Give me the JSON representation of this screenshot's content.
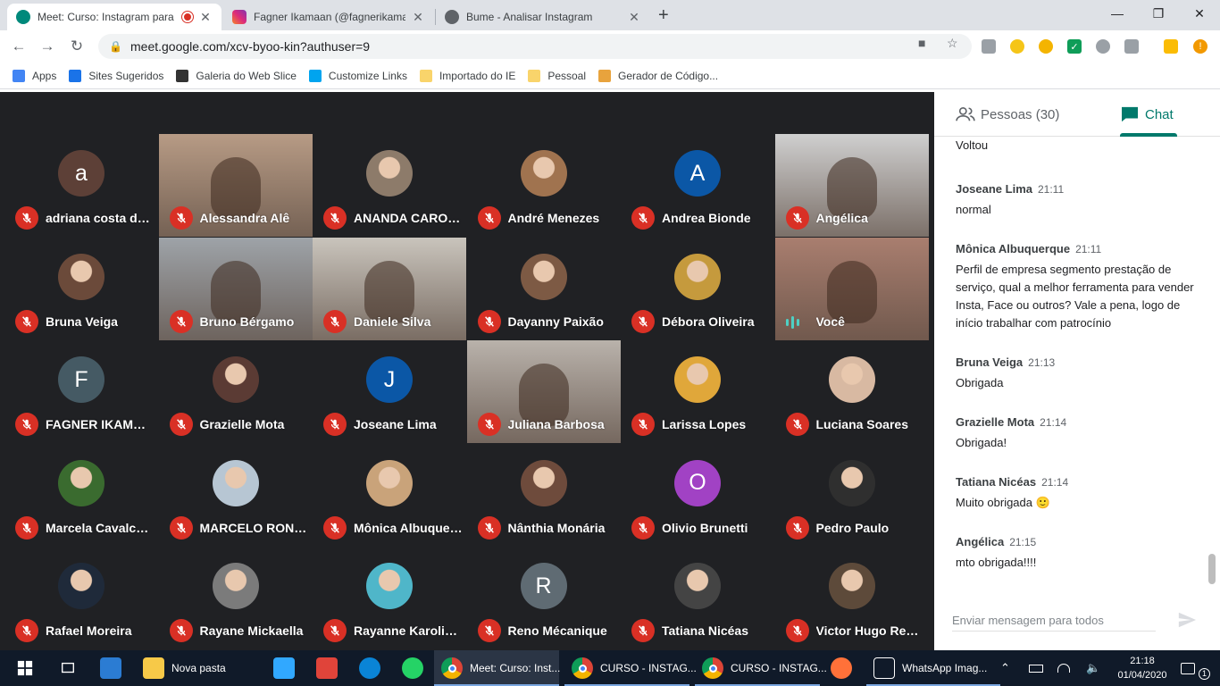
{
  "browser": {
    "tabs": [
      {
        "title": "Meet: Curso: Instagram para",
        "color": "#00897b"
      },
      {
        "title": "Fagner Ikamaan (@fagnerikamaan",
        "color": "#c13584"
      },
      {
        "title": "Bume - Analisar Instagram",
        "color": "#5f6368"
      }
    ],
    "new_tab": "+",
    "window_controls": {
      "minimize": "—",
      "maximize": "❐",
      "close": "✕"
    },
    "url": "meet.google.com/xcv-byoo-kin?authuser=9",
    "bookmarks": [
      {
        "label": "Apps",
        "color": "#4285f4"
      },
      {
        "label": "Sites Sugeridos",
        "color": "#1a73e8"
      },
      {
        "label": "Galeria do Web Slice",
        "color": "#333333"
      },
      {
        "label": "Customize Links",
        "color": "#00a4ef"
      },
      {
        "label": "Importado do IE",
        "color": "#f9d46b"
      },
      {
        "label": "Pessoal",
        "color": "#f9d46b"
      },
      {
        "label": "Gerador de Código...",
        "color": "#e8a33d"
      }
    ]
  },
  "participants": [
    {
      "name": "adriana costa de m...",
      "initial": "a",
      "avatar_color": "#5d4037",
      "type": "initial"
    },
    {
      "name": "Alessandra Alê",
      "type": "video",
      "bg": "#b79b85"
    },
    {
      "name": "ANANDA CAROLIN...",
      "type": "photo",
      "avatar_color": "#8d7b6a"
    },
    {
      "name": "André Menezes",
      "type": "photo",
      "avatar_color": "#a0734f"
    },
    {
      "name": "Andrea Bionde",
      "initial": "A",
      "avatar_color": "#0b57a6",
      "type": "initial"
    },
    {
      "name": "Angélica",
      "type": "video",
      "bg": "#cfcfcf"
    },
    {
      "name": "Bruna Veiga",
      "type": "photo",
      "avatar_color": "#6b4a3a"
    },
    {
      "name": "Bruno Bérgamo",
      "type": "video",
      "bg": "#9ea3a8"
    },
    {
      "name": "Daniele Silva",
      "type": "video",
      "bg": "#c9c4bc"
    },
    {
      "name": "Dayanny Paixão",
      "type": "photo",
      "avatar_color": "#7d5a44"
    },
    {
      "name": "Débora Oliveira",
      "type": "photo",
      "avatar_color": "#c59a3d"
    },
    {
      "name": "Você",
      "type": "video-self",
      "bg": "#a97e6f"
    },
    {
      "name": "FAGNER IKAMAAN...",
      "initial": "F",
      "avatar_color": "#455a64",
      "type": "initial"
    },
    {
      "name": "Grazielle Mota",
      "type": "photo",
      "avatar_color": "#5b3b34"
    },
    {
      "name": "Joseane Lima",
      "initial": "J",
      "avatar_color": "#0b57a6",
      "type": "initial"
    },
    {
      "name": "Juliana Barbosa",
      "type": "video",
      "bg": "#b9b2ab"
    },
    {
      "name": "Larissa Lopes",
      "type": "photo",
      "avatar_color": "#e0a73a"
    },
    {
      "name": "Luciana Soares",
      "type": "photo",
      "avatar_color": "#d8b9a2"
    },
    {
      "name": "Marcela Cavalcanti",
      "type": "photo",
      "avatar_color": "#3a6b2f"
    },
    {
      "name": "MARCELO RONDIN...",
      "type": "photo",
      "avatar_color": "#b7c6d3"
    },
    {
      "name": "Mônica Albuquerque",
      "type": "photo",
      "avatar_color": "#c9a37a"
    },
    {
      "name": "Nânthia Monária",
      "type": "photo",
      "avatar_color": "#6e4b3c"
    },
    {
      "name": "Olivio Brunetti",
      "initial": "O",
      "avatar_color": "#a142c4",
      "type": "initial"
    },
    {
      "name": "Pedro Paulo",
      "type": "photo",
      "avatar_color": "#2f2f2f"
    },
    {
      "name": "Rafael Moreira",
      "type": "photo",
      "avatar_color": "#1f2a3a"
    },
    {
      "name": "Rayane Mickaella",
      "type": "photo",
      "avatar_color": "#7b7b7b"
    },
    {
      "name": "Rayanne Karoline d...",
      "type": "photo",
      "avatar_color": "#4fb6c9"
    },
    {
      "name": "Reno Mécanique",
      "initial": "R",
      "avatar_color": "#5f6b73",
      "type": "initial"
    },
    {
      "name": "Tatiana Nicéas",
      "type": "photo",
      "avatar_color": "#444444"
    },
    {
      "name": "Victor Hugo Renier ...",
      "type": "photo",
      "avatar_color": "#5d4a3a"
    }
  ],
  "panel": {
    "people_tab": "Pessoas (30)",
    "chat_tab": "Chat",
    "accent": "#00796b",
    "messages": [
      {
        "sender": "",
        "time": "",
        "text": "Voltou"
      },
      {
        "sender": "Joseane Lima",
        "time": "21:11",
        "text": "normal"
      },
      {
        "sender": "Mônica Albuquerque",
        "time": "21:11",
        "text": "Perfil de empresa segmento prestação de serviço, qual a melhor ferramenta para vender Insta, Face ou outros? Vale a pena, logo de início   trabalhar com patrocínio"
      },
      {
        "sender": "Bruna Veiga",
        "time": "21:13",
        "text": "Obrigada"
      },
      {
        "sender": "Grazielle Mota",
        "time": "21:14",
        "text": "Obrigada!"
      },
      {
        "sender": "Tatiana Nicéas",
        "time": "21:14",
        "text": "Muito obrigada 🙂"
      },
      {
        "sender": "Angélica",
        "time": "21:15",
        "text": "mto obrigada!!!!"
      }
    ],
    "compose_placeholder": "Enviar mensagem para todos"
  },
  "taskbar": {
    "apps": [
      {
        "label": "",
        "icon": "windows-start",
        "color": "#ffffff"
      },
      {
        "label": "",
        "icon": "task-view",
        "color": "#ffffff"
      },
      {
        "label": "",
        "icon": "mail",
        "color": "#2b7cd3"
      },
      {
        "label": "Nova pasta",
        "icon": "folder",
        "color": "#f7c948"
      },
      {
        "label": "",
        "icon": "photoshop",
        "color": "#31a8ff"
      },
      {
        "label": "",
        "icon": "app-red",
        "color": "#e0443a"
      },
      {
        "label": "",
        "icon": "edge",
        "color": "#0a84d6"
      },
      {
        "label": "",
        "icon": "whatsapp",
        "color": "#25d366"
      },
      {
        "label": "Meet: Curso: Inst...",
        "icon": "chrome",
        "color": "#4285f4"
      },
      {
        "label": "CURSO - INSTAG...",
        "icon": "chrome",
        "color": "#4285f4"
      },
      {
        "label": "CURSO - INSTAG...",
        "icon": "chrome",
        "color": "#4285f4"
      },
      {
        "label": "",
        "icon": "firefox",
        "color": "#ff7139"
      },
      {
        "label": "WhatsApp Imag...",
        "icon": "photos",
        "color": "#ffffff"
      }
    ],
    "time": "21:18",
    "date": "01/04/2020",
    "notification_count": "1"
  }
}
